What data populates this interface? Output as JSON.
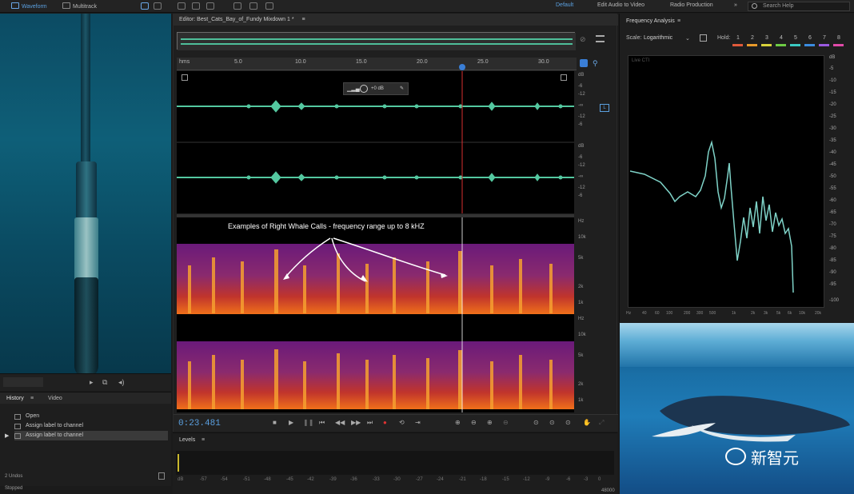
{
  "topbar": {
    "waveform": "Waveform",
    "multitrack": "Multitrack",
    "workspace": "Default",
    "workspaces": [
      "Edit Audio to Video",
      "Radio Production"
    ],
    "search_placeholder": "Search Help"
  },
  "editor": {
    "tab_title": "Editor: Best_Cats_Bay_of_Fundy Mixdown 1 *",
    "ruler_unit": "hms",
    "ruler_ticks": [
      "5.0",
      "10.0",
      "15.0",
      "20.0",
      "25.0",
      "30.0"
    ],
    "amp_readout": "+0 dB",
    "annotation": "Examples of Right Whale Calls - frequency range up to 8 kHZ",
    "time": "0:23.481",
    "db_scale_top": [
      "dB",
      "-6",
      "-12",
      "-∞",
      "-12",
      "-6"
    ],
    "db_scale_bottom": [
      "dB",
      "-6",
      "-12",
      "-∞",
      "-12",
      "-6"
    ],
    "hz_scale_top": [
      "Hz",
      "10k",
      "5k",
      "2k",
      "1k"
    ],
    "hz_scale_bottom": [
      "Hz",
      "10k",
      "5k",
      "2k",
      "1k"
    ]
  },
  "history": {
    "tab_history": "History",
    "tab_video": "Video",
    "items": [
      "Open",
      "Assign label to channel",
      "Assign label to channel"
    ],
    "undo_count": "2 Undos"
  },
  "levels": {
    "title": "Levels",
    "scale": [
      "dB",
      "-57",
      "-54",
      "-51",
      "-48",
      "-45",
      "-42",
      "-39",
      "-36",
      "-33",
      "-30",
      "-27",
      "-24",
      "-21",
      "-18",
      "-15",
      "-12",
      "-9",
      "-6",
      "-3",
      "0"
    ]
  },
  "status": {
    "text": "Stopped",
    "rate": "48000"
  },
  "freq": {
    "title": "Frequency Analysis",
    "scale_label": "Scale:",
    "scale_value": "Logarithmic",
    "hold_label": "Hold:",
    "hold_buttons": [
      "1",
      "2",
      "3",
      "4",
      "5",
      "6",
      "7",
      "8"
    ],
    "hold_colors": [
      "#e05a3a",
      "#e89a2a",
      "#d8d23a",
      "#6dcc44",
      "#3ac9c2",
      "#3a8ce0",
      "#9a5ae0",
      "#e04aa8"
    ],
    "live_label": "Live CTI",
    "y_scale": [
      "dB",
      "-5",
      "-10",
      "-15",
      "-20",
      "-25",
      "-30",
      "-35",
      "-40",
      "-45",
      "-50",
      "-55",
      "-60",
      "-65",
      "-70",
      "-75",
      "-80",
      "-85",
      "-90",
      "-95",
      "-100"
    ],
    "x_scale": [
      "Hz",
      "40",
      "60",
      "100",
      "200",
      "300",
      "500",
      "1k",
      "2k",
      "3k",
      "5k",
      "6k",
      "10k",
      "20k"
    ],
    "line_color": "#7fd3c8"
  },
  "watermark": {
    "text": "新智元"
  }
}
